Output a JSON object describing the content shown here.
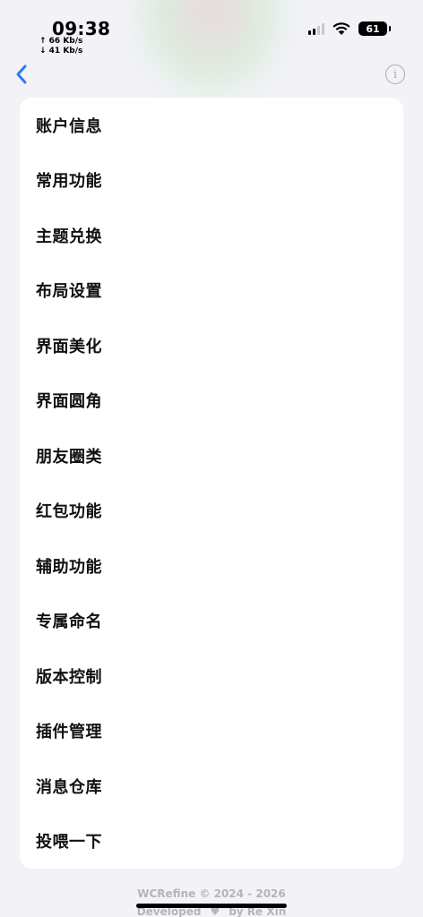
{
  "status_bar": {
    "time": "09:38",
    "upload_speed": "↑ 66 Kb/s",
    "download_speed": "↓ 41 Kb/s",
    "battery": "61"
  },
  "nav": {
    "back_icon": "chevron-left-icon",
    "info_icon": "info-icon",
    "info_glyph": "i",
    "accent_color": "#3478f6"
  },
  "menu": {
    "items": [
      {
        "label": "账户信息"
      },
      {
        "label": "常用功能"
      },
      {
        "label": "主题兑换"
      },
      {
        "label": "布局设置"
      },
      {
        "label": "界面美化"
      },
      {
        "label": "界面圆角"
      },
      {
        "label": "朋友圈类"
      },
      {
        "label": "红包功能"
      },
      {
        "label": "辅助功能"
      },
      {
        "label": "专属命名"
      },
      {
        "label": "版本控制"
      },
      {
        "label": "插件管理"
      },
      {
        "label": "消息仓库"
      },
      {
        "label": "投喂一下"
      }
    ]
  },
  "footer": {
    "copyright": "WCRefine © 2024 - 2026",
    "developed": "Developed",
    "heart": "♥",
    "by": "by  Re Xin"
  }
}
